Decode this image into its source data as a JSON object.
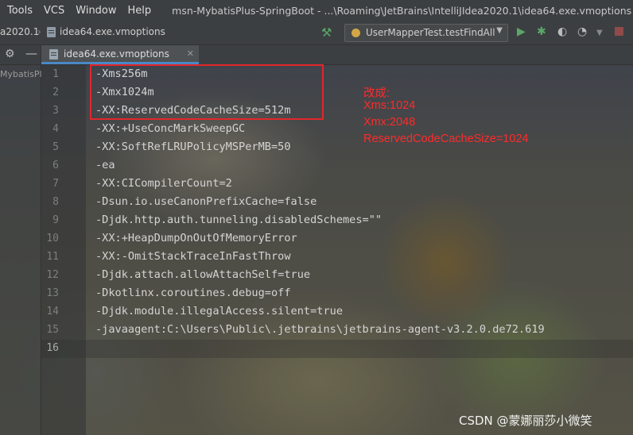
{
  "menubar": {
    "items": [
      "Tools",
      "VCS",
      "Window",
      "Help"
    ],
    "title": "msn-MybatisPlus-SpringBoot - ...\\Roaming\\JetBrains\\IntelliJIdea2020.1\\idea64.exe.vmoptions"
  },
  "toolbar": {
    "crumb_project": "a2020.1",
    "crumb_file": "idea64.exe.vmoptions",
    "run_config": "UserMapperTest.testFindAll"
  },
  "sidebar": {
    "project_label": "MybatisPl"
  },
  "editor": {
    "tab_label": "idea64.exe.vmoptions",
    "lines": [
      {
        "num": "1",
        "text": "-Xms256m"
      },
      {
        "num": "2",
        "text": "-Xmx1024m"
      },
      {
        "num": "3",
        "text": "-XX:ReservedCodeCacheSize=512m"
      },
      {
        "num": "4",
        "text": "-XX:+UseConcMarkSweepGC"
      },
      {
        "num": "5",
        "text": "-XX:SoftRefLRUPolicyMSPerMB=50"
      },
      {
        "num": "6",
        "text": "-ea"
      },
      {
        "num": "7",
        "text": "-XX:CICompilerCount=2"
      },
      {
        "num": "8",
        "text": "-Dsun.io.useCanonPrefixCache=false"
      },
      {
        "num": "9",
        "text": "-Djdk.http.auth.tunneling.disabledSchemes=\"\""
      },
      {
        "num": "10",
        "text": "-XX:+HeapDumpOnOutOfMemoryError"
      },
      {
        "num": "11",
        "text": "-XX:-OmitStackTraceInFastThrow"
      },
      {
        "num": "12",
        "text": "-Djdk.attach.allowAttachSelf=true"
      },
      {
        "num": "13",
        "text": "-Dkotlinx.coroutines.debug=off"
      },
      {
        "num": "14",
        "text": "-Djdk.module.illegalAccess.silent=true"
      },
      {
        "num": "15",
        "text": "-javaagent:C:\\Users\\Public\\.jetbrains\\jetbrains-agent-v3.2.0.de72.619"
      },
      {
        "num": "16",
        "text": ""
      }
    ]
  },
  "annotation": {
    "lines": [
      "改成:",
      "Xms:1024",
      "Xmx:2048",
      "ReservedCodeCacheSize=1024"
    ],
    "color": "#ff2a2a"
  },
  "watermark": "CSDN @蒙娜丽莎小微笑",
  "icons": {
    "build": "hammer-icon",
    "run": "run-icon",
    "debug": "debug-icon",
    "coverage": "coverage-icon",
    "profile": "profile-icon",
    "stop": "stop-icon"
  }
}
